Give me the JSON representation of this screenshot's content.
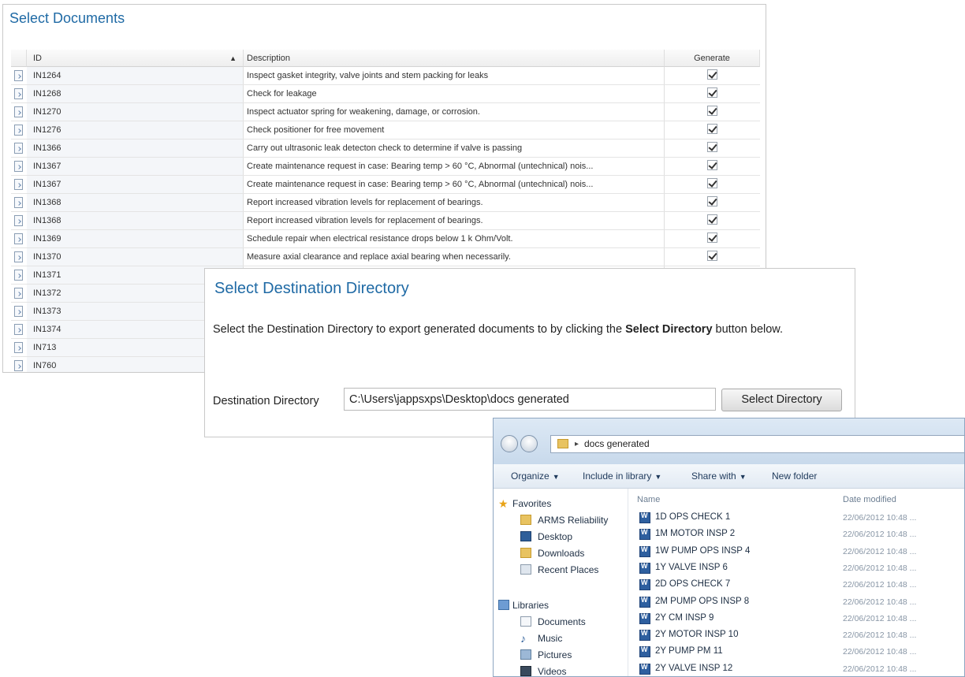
{
  "docs_panel": {
    "title": "Select Documents",
    "columns": {
      "id": "ID",
      "sort_indicator": "▲",
      "description": "Description",
      "generate": "Generate"
    },
    "rows": [
      {
        "id": "IN1264",
        "description": "Inspect gasket integrity, valve joints and stem packing for leaks",
        "generate": true
      },
      {
        "id": "IN1268",
        "description": "Check for leakage",
        "generate": true
      },
      {
        "id": "IN1270",
        "description": "Inspect actuator spring for weakening, damage, or corrosion.",
        "generate": true
      },
      {
        "id": "IN1276",
        "description": "Check positioner for free movement",
        "generate": true
      },
      {
        "id": "IN1366",
        "description": "Carry out ultrasonic leak detecton check to determine if valve is passing",
        "generate": true
      },
      {
        "id": "IN1367",
        "description": "Create maintenance request in case: Bearing temp > 60 °C, Abnormal (untechnical) nois...",
        "generate": true
      },
      {
        "id": "IN1367",
        "description": "Create maintenance request in case: Bearing temp > 60 °C, Abnormal (untechnical) nois...",
        "generate": true
      },
      {
        "id": "IN1368",
        "description": "Report increased vibration levels for replacement of bearings.",
        "generate": true
      },
      {
        "id": "IN1368",
        "description": "Report increased vibration levels for replacement of bearings.",
        "generate": true
      },
      {
        "id": "IN1369",
        "description": "Schedule repair when electrical resistance drops below 1 k Ohm/Volt.",
        "generate": true
      },
      {
        "id": "IN1370",
        "description": "Measure axial clearance and replace axial bearing when necessarily.",
        "generate": true
      },
      {
        "id": "IN1371",
        "description": "",
        "generate": false
      },
      {
        "id": "IN1372",
        "description": "",
        "generate": false
      },
      {
        "id": "IN1373",
        "description": "",
        "generate": false
      },
      {
        "id": "IN1374",
        "description": "",
        "generate": false
      },
      {
        "id": "IN713",
        "description": "",
        "generate": false
      },
      {
        "id": "IN760",
        "description": "",
        "generate": false
      }
    ]
  },
  "dest_panel": {
    "title": "Select Destination Directory",
    "desc_prefix": "Select the Destination Directory to export generated documents to by clicking the ",
    "desc_bold": "Select Directory",
    "desc_suffix": " button below.",
    "label": "Destination Directory",
    "path_value": "C:\\Users\\jappsxps\\Desktop\\docs generated",
    "button_label": "Select Directory"
  },
  "explorer": {
    "address_sep": "▸",
    "address_path": "docs generated",
    "toolbar": [
      {
        "label": "Organize",
        "caret": "▼"
      },
      {
        "label": "Include in library",
        "caret": "▼"
      },
      {
        "label": "Share with",
        "caret": "▼"
      },
      {
        "label": "New folder",
        "caret": ""
      }
    ],
    "nav": {
      "favorites": "Favorites",
      "favorites_items": [
        "ARMS Reliability",
        "Desktop",
        "Downloads",
        "Recent Places"
      ],
      "libraries": "Libraries",
      "libraries_items": [
        "Documents",
        "Music",
        "Pictures",
        "Videos"
      ]
    },
    "columns": {
      "name": "Name",
      "date": "Date modified"
    },
    "files": [
      {
        "name": "1D OPS CHECK 1",
        "date": "22/06/2012 10:48 ..."
      },
      {
        "name": "1M MOTOR INSP 2",
        "date": "22/06/2012 10:48 ..."
      },
      {
        "name": "1W PUMP OPS INSP 4",
        "date": "22/06/2012 10:48 ..."
      },
      {
        "name": "1Y VALVE INSP 6",
        "date": "22/06/2012 10:48 ..."
      },
      {
        "name": "2D OPS CHECK 7",
        "date": "22/06/2012 10:48 ..."
      },
      {
        "name": "2M PUMP OPS INSP 8",
        "date": "22/06/2012 10:48 ..."
      },
      {
        "name": "2Y CM INSP 9",
        "date": "22/06/2012 10:48 ..."
      },
      {
        "name": "2Y MOTOR INSP 10",
        "date": "22/06/2012 10:48 ..."
      },
      {
        "name": "2Y PUMP PM 11",
        "date": "22/06/2012 10:48 ..."
      },
      {
        "name": "2Y VALVE INSP 12",
        "date": "22/06/2012 10:48 ..."
      }
    ]
  }
}
